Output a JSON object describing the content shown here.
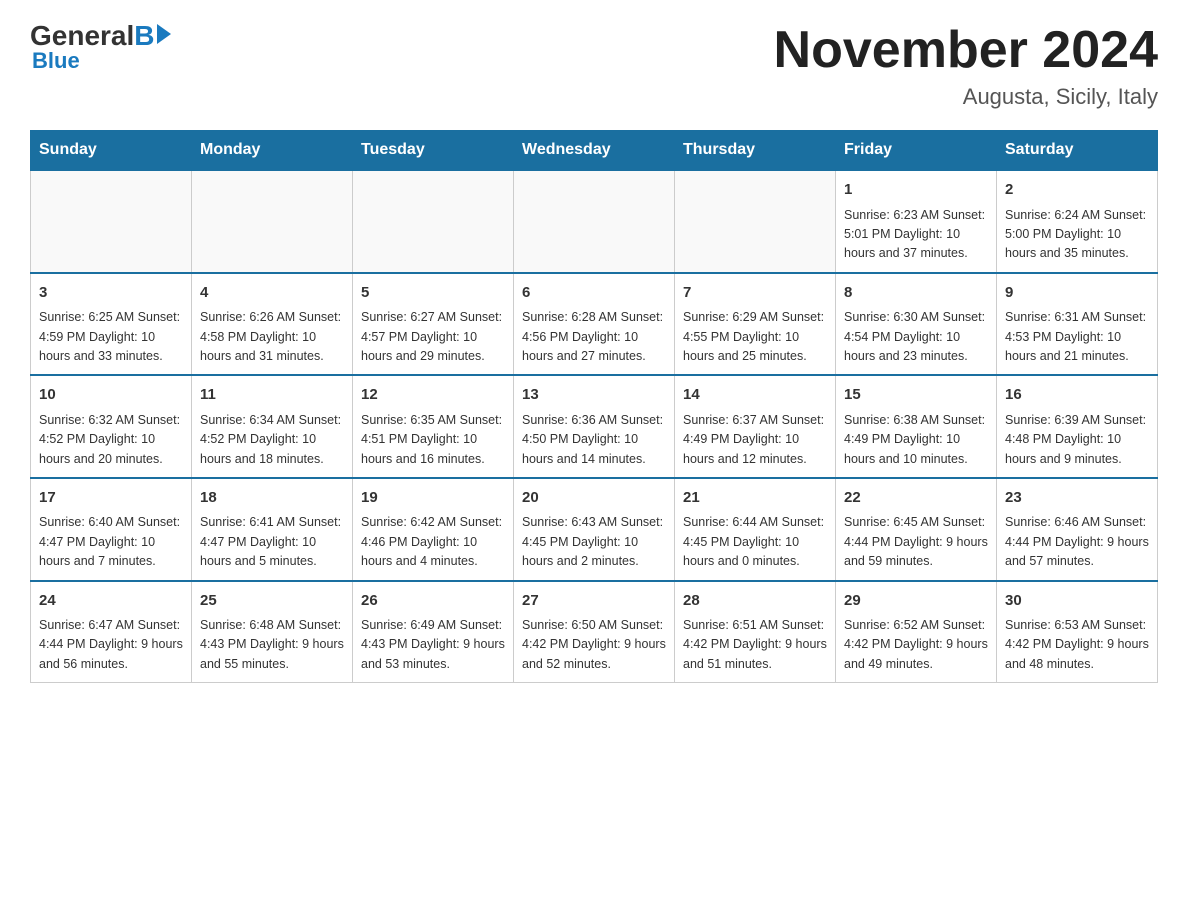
{
  "header": {
    "logo": {
      "general": "General",
      "blue": "Blue",
      "arrow": "▶"
    },
    "title": "November 2024",
    "subtitle": "Augusta, Sicily, Italy"
  },
  "calendar": {
    "headers": [
      "Sunday",
      "Monday",
      "Tuesday",
      "Wednesday",
      "Thursday",
      "Friday",
      "Saturday"
    ],
    "weeks": [
      [
        {
          "day": "",
          "info": ""
        },
        {
          "day": "",
          "info": ""
        },
        {
          "day": "",
          "info": ""
        },
        {
          "day": "",
          "info": ""
        },
        {
          "day": "",
          "info": ""
        },
        {
          "day": "1",
          "info": "Sunrise: 6:23 AM\nSunset: 5:01 PM\nDaylight: 10 hours and 37 minutes."
        },
        {
          "day": "2",
          "info": "Sunrise: 6:24 AM\nSunset: 5:00 PM\nDaylight: 10 hours and 35 minutes."
        }
      ],
      [
        {
          "day": "3",
          "info": "Sunrise: 6:25 AM\nSunset: 4:59 PM\nDaylight: 10 hours and 33 minutes."
        },
        {
          "day": "4",
          "info": "Sunrise: 6:26 AM\nSunset: 4:58 PM\nDaylight: 10 hours and 31 minutes."
        },
        {
          "day": "5",
          "info": "Sunrise: 6:27 AM\nSunset: 4:57 PM\nDaylight: 10 hours and 29 minutes."
        },
        {
          "day": "6",
          "info": "Sunrise: 6:28 AM\nSunset: 4:56 PM\nDaylight: 10 hours and 27 minutes."
        },
        {
          "day": "7",
          "info": "Sunrise: 6:29 AM\nSunset: 4:55 PM\nDaylight: 10 hours and 25 minutes."
        },
        {
          "day": "8",
          "info": "Sunrise: 6:30 AM\nSunset: 4:54 PM\nDaylight: 10 hours and 23 minutes."
        },
        {
          "day": "9",
          "info": "Sunrise: 6:31 AM\nSunset: 4:53 PM\nDaylight: 10 hours and 21 minutes."
        }
      ],
      [
        {
          "day": "10",
          "info": "Sunrise: 6:32 AM\nSunset: 4:52 PM\nDaylight: 10 hours and 20 minutes."
        },
        {
          "day": "11",
          "info": "Sunrise: 6:34 AM\nSunset: 4:52 PM\nDaylight: 10 hours and 18 minutes."
        },
        {
          "day": "12",
          "info": "Sunrise: 6:35 AM\nSunset: 4:51 PM\nDaylight: 10 hours and 16 minutes."
        },
        {
          "day": "13",
          "info": "Sunrise: 6:36 AM\nSunset: 4:50 PM\nDaylight: 10 hours and 14 minutes."
        },
        {
          "day": "14",
          "info": "Sunrise: 6:37 AM\nSunset: 4:49 PM\nDaylight: 10 hours and 12 minutes."
        },
        {
          "day": "15",
          "info": "Sunrise: 6:38 AM\nSunset: 4:49 PM\nDaylight: 10 hours and 10 minutes."
        },
        {
          "day": "16",
          "info": "Sunrise: 6:39 AM\nSunset: 4:48 PM\nDaylight: 10 hours and 9 minutes."
        }
      ],
      [
        {
          "day": "17",
          "info": "Sunrise: 6:40 AM\nSunset: 4:47 PM\nDaylight: 10 hours and 7 minutes."
        },
        {
          "day": "18",
          "info": "Sunrise: 6:41 AM\nSunset: 4:47 PM\nDaylight: 10 hours and 5 minutes."
        },
        {
          "day": "19",
          "info": "Sunrise: 6:42 AM\nSunset: 4:46 PM\nDaylight: 10 hours and 4 minutes."
        },
        {
          "day": "20",
          "info": "Sunrise: 6:43 AM\nSunset: 4:45 PM\nDaylight: 10 hours and 2 minutes."
        },
        {
          "day": "21",
          "info": "Sunrise: 6:44 AM\nSunset: 4:45 PM\nDaylight: 10 hours and 0 minutes."
        },
        {
          "day": "22",
          "info": "Sunrise: 6:45 AM\nSunset: 4:44 PM\nDaylight: 9 hours and 59 minutes."
        },
        {
          "day": "23",
          "info": "Sunrise: 6:46 AM\nSunset: 4:44 PM\nDaylight: 9 hours and 57 minutes."
        }
      ],
      [
        {
          "day": "24",
          "info": "Sunrise: 6:47 AM\nSunset: 4:44 PM\nDaylight: 9 hours and 56 minutes."
        },
        {
          "day": "25",
          "info": "Sunrise: 6:48 AM\nSunset: 4:43 PM\nDaylight: 9 hours and 55 minutes."
        },
        {
          "day": "26",
          "info": "Sunrise: 6:49 AM\nSunset: 4:43 PM\nDaylight: 9 hours and 53 minutes."
        },
        {
          "day": "27",
          "info": "Sunrise: 6:50 AM\nSunset: 4:42 PM\nDaylight: 9 hours and 52 minutes."
        },
        {
          "day": "28",
          "info": "Sunrise: 6:51 AM\nSunset: 4:42 PM\nDaylight: 9 hours and 51 minutes."
        },
        {
          "day": "29",
          "info": "Sunrise: 6:52 AM\nSunset: 4:42 PM\nDaylight: 9 hours and 49 minutes."
        },
        {
          "day": "30",
          "info": "Sunrise: 6:53 AM\nSunset: 4:42 PM\nDaylight: 9 hours and 48 minutes."
        }
      ]
    ]
  }
}
